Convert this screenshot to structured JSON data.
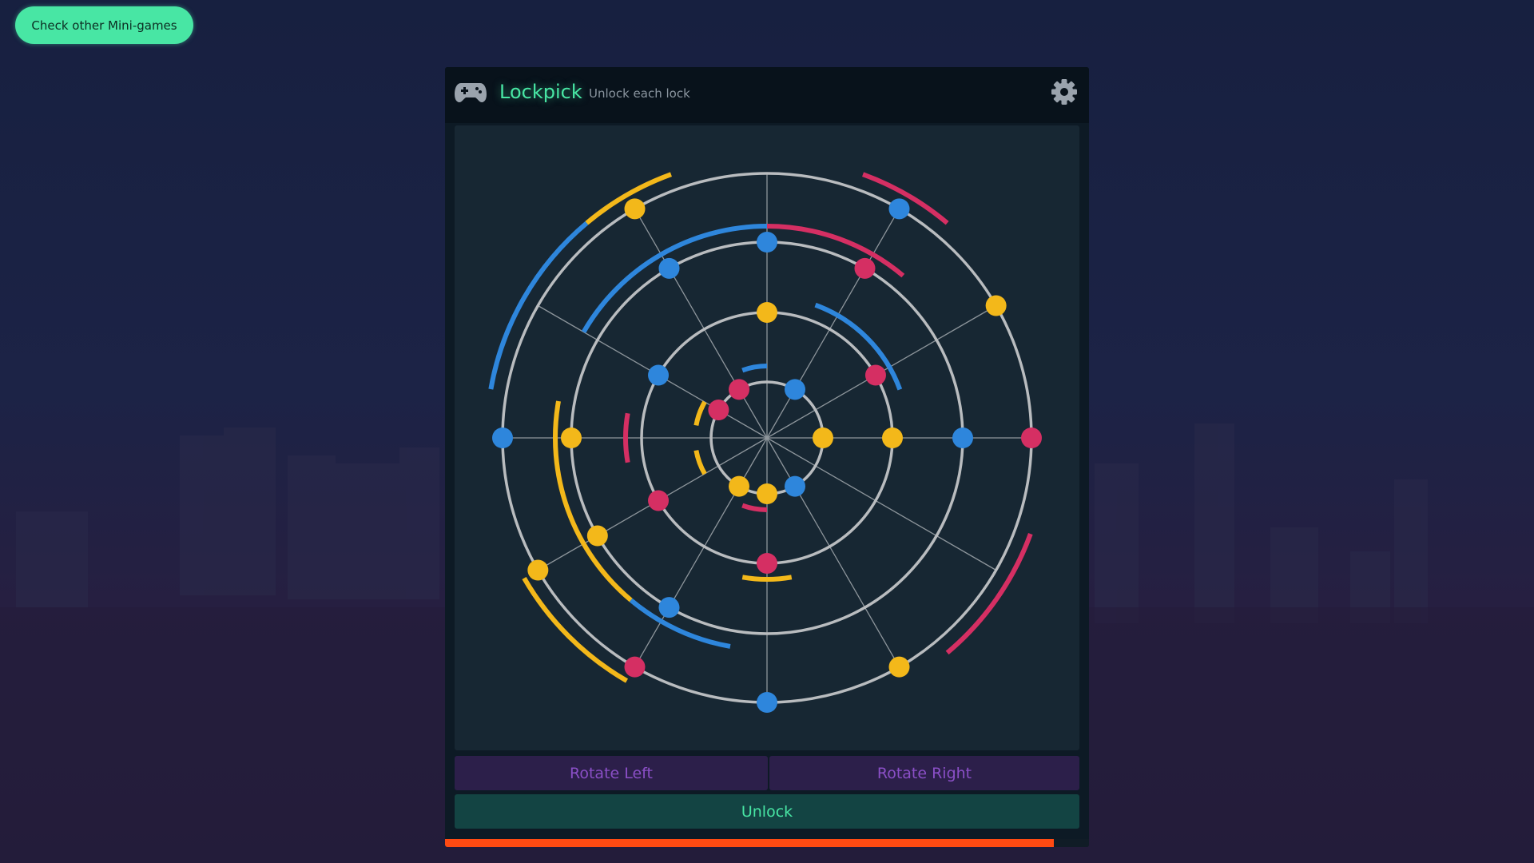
{
  "nav": {
    "mini_games_label": "Check other Mini-games"
  },
  "header": {
    "icon": "gamepad-icon",
    "title": "Lockpick",
    "subtitle": "Unlock each lock",
    "settings_icon": "gear-icon"
  },
  "colors": {
    "red": "#d52f63",
    "blue": "#2e86dc",
    "yellow": "#f3b81a",
    "accent": "#48e6a4",
    "timer": "#ff4a12"
  },
  "lock": {
    "spokes_deg": [
      0,
      30,
      60,
      90,
      120,
      150,
      180,
      210,
      240,
      270,
      300,
      330
    ],
    "rings": [
      {
        "pins": [
          {
            "deg": 0,
            "color": "yellow"
          },
          {
            "deg": 60,
            "color": "blue"
          },
          {
            "deg": 90,
            "color": "yellow"
          },
          {
            "deg": 120,
            "color": "yellow"
          },
          {
            "deg": 210,
            "color": "red"
          },
          {
            "deg": 240,
            "color": "red"
          },
          {
            "deg": 300,
            "color": "blue"
          }
        ],
        "arcs": [
          {
            "from": 90,
            "to": 110,
            "color": "red"
          },
          {
            "from": 150,
            "to": 170,
            "color": "yellow"
          },
          {
            "from": 190,
            "to": 210,
            "color": "yellow"
          },
          {
            "from": 250,
            "to": 270,
            "color": "blue"
          }
        ]
      },
      {
        "pins": [
          {
            "deg": 0,
            "color": "yellow"
          },
          {
            "deg": 90,
            "color": "red"
          },
          {
            "deg": 150,
            "color": "red"
          },
          {
            "deg": 210,
            "color": "blue"
          },
          {
            "deg": 270,
            "color": "yellow"
          },
          {
            "deg": 330,
            "color": "red"
          }
        ],
        "arcs": [
          {
            "from": 80,
            "to": 100,
            "color": "yellow"
          },
          {
            "from": 170,
            "to": 190,
            "color": "red"
          },
          {
            "from": 290,
            "to": 340,
            "color": "blue"
          }
        ]
      },
      {
        "pins": [
          {
            "deg": 0,
            "color": "blue"
          },
          {
            "deg": 120,
            "color": "blue"
          },
          {
            "deg": 150,
            "color": "yellow"
          },
          {
            "deg": 180,
            "color": "yellow"
          },
          {
            "deg": 240,
            "color": "blue"
          },
          {
            "deg": 270,
            "color": "blue"
          },
          {
            "deg": 300,
            "color": "red"
          }
        ],
        "arcs": [
          {
            "from": 100,
            "to": 130,
            "color": "blue"
          },
          {
            "from": 130,
            "to": 190,
            "color": "yellow"
          },
          {
            "from": 210,
            "to": 270,
            "color": "blue"
          },
          {
            "from": 270,
            "to": 310,
            "color": "red"
          }
        ]
      },
      {
        "pins": [
          {
            "deg": 0,
            "color": "red"
          },
          {
            "deg": 60,
            "color": "yellow"
          },
          {
            "deg": 90,
            "color": "blue"
          },
          {
            "deg": 120,
            "color": "red"
          },
          {
            "deg": 150,
            "color": "yellow"
          },
          {
            "deg": 180,
            "color": "blue"
          },
          {
            "deg": 240,
            "color": "yellow"
          },
          {
            "deg": 300,
            "color": "blue"
          },
          {
            "deg": 330,
            "color": "yellow"
          }
        ],
        "arcs": [
          {
            "from": 20,
            "to": 50,
            "color": "red"
          },
          {
            "from": 120,
            "to": 150,
            "color": "yellow"
          },
          {
            "from": 190,
            "to": 230,
            "color": "blue"
          },
          {
            "from": 230,
            "to": 250,
            "color": "yellow"
          },
          {
            "from": 290,
            "to": 310,
            "color": "red"
          }
        ]
      }
    ]
  },
  "controls": {
    "rotate_left_label": "Rotate Left",
    "rotate_right_label": "Rotate Right",
    "unlock_label": "Unlock"
  },
  "timer": {
    "remaining_fraction": 0.945
  }
}
